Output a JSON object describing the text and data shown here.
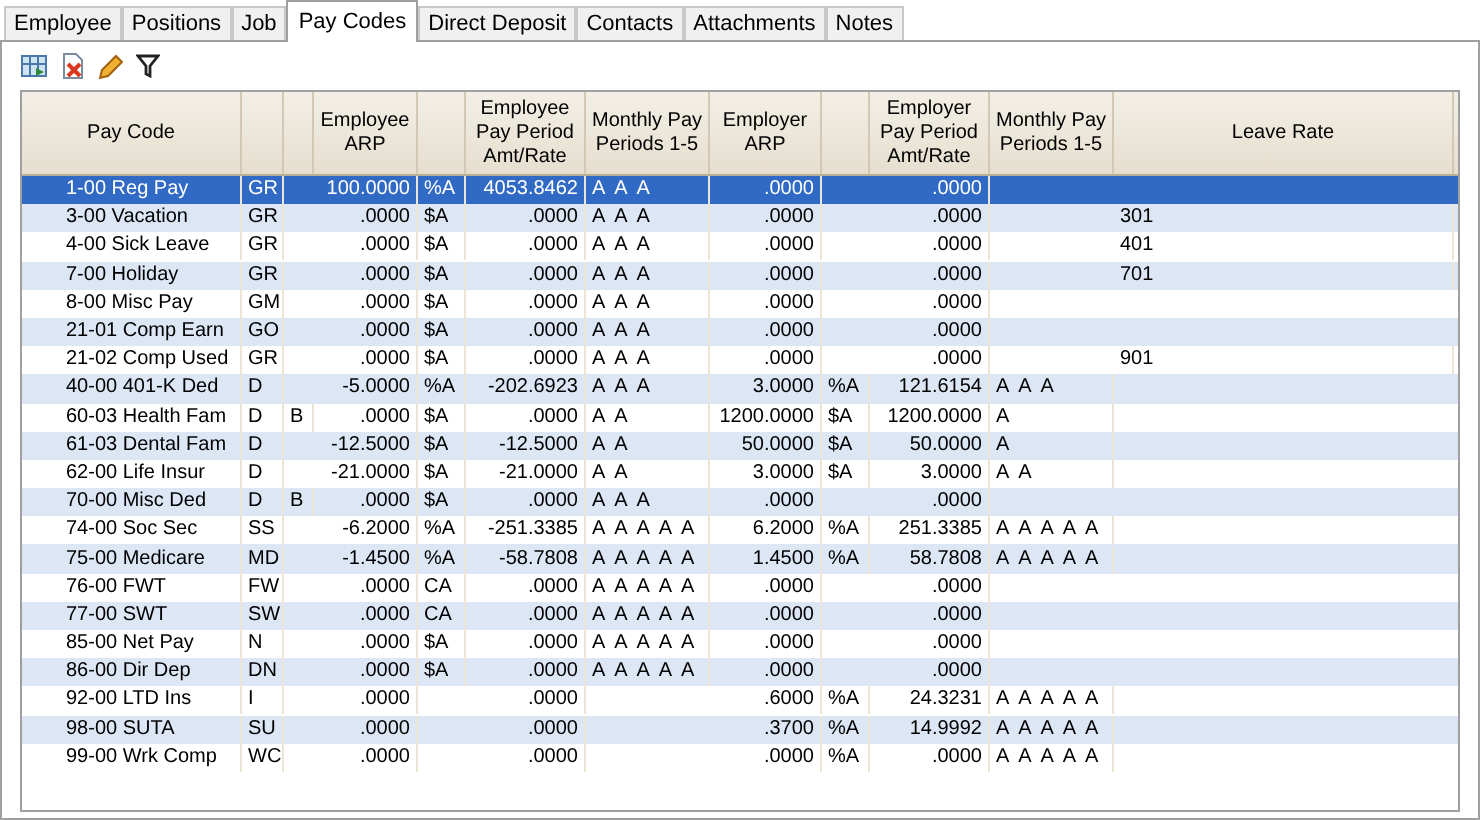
{
  "tabs": [
    {
      "label": "Employee",
      "selected": false
    },
    {
      "label": "Positions",
      "selected": false
    },
    {
      "label": "Job",
      "selected": false
    },
    {
      "label": "Pay Codes",
      "selected": true
    },
    {
      "label": "Direct Deposit",
      "selected": false
    },
    {
      "label": "Contacts",
      "selected": false
    },
    {
      "label": "Attachments",
      "selected": false
    },
    {
      "label": "Notes",
      "selected": false
    }
  ],
  "table": {
    "columns": [
      "Pay Code",
      "",
      "",
      "Employee ARP",
      "",
      "Employee Pay Period Amt/Rate",
      "Monthly Pay Periods 1-5",
      "Employer ARP",
      "",
      "Employer Pay Period Amt/Rate",
      "Monthly Pay Periods 1-5",
      "Leave Rate"
    ],
    "rows": [
      {
        "cells": [
          "1-00 Reg Pay",
          "GR",
          "",
          "100.0000",
          "%A",
          "4053.8462",
          "A  A  A",
          ".0000",
          "",
          ".0000",
          "",
          ""
        ],
        "selected": true
      },
      {
        "cells": [
          "3-00 Vacation",
          "GR",
          "",
          ".0000",
          "$A",
          ".0000",
          "A  A  A",
          ".0000",
          "",
          ".0000",
          "",
          "301"
        ],
        "selected": false
      },
      {
        "cells": [
          "4-00 Sick Leave",
          "GR",
          "",
          ".0000",
          "$A",
          ".0000",
          "A  A  A",
          ".0000",
          "",
          ".0000",
          "",
          "401"
        ],
        "selected": false
      },
      {
        "cells": [
          "7-00 Holiday",
          "GR",
          "",
          ".0000",
          "$A",
          ".0000",
          "A  A  A",
          ".0000",
          "",
          ".0000",
          "",
          "701"
        ],
        "selected": false
      },
      {
        "cells": [
          "8-00 Misc Pay",
          "GM",
          "",
          ".0000",
          "$A",
          ".0000",
          "A  A  A",
          ".0000",
          "",
          ".0000",
          "",
          ""
        ],
        "selected": false
      },
      {
        "cells": [
          "21-01 Comp Earn",
          "GO",
          "",
          ".0000",
          "$A",
          ".0000",
          "A  A  A",
          ".0000",
          "",
          ".0000",
          "",
          ""
        ],
        "selected": false
      },
      {
        "cells": [
          "21-02 Comp Used",
          "GR",
          "",
          ".0000",
          "$A",
          ".0000",
          "A  A  A",
          ".0000",
          "",
          ".0000",
          "",
          "901"
        ],
        "selected": false
      },
      {
        "cells": [
          "40-00 401-K Ded",
          "D",
          "",
          "-5.0000",
          "%A",
          "-202.6923",
          "A  A  A",
          "3.0000",
          "%A",
          "121.6154",
          "A  A  A",
          ""
        ],
        "selected": false
      },
      {
        "cells": [
          "60-03 Health Fam",
          "D",
          "B",
          ".0000",
          "$A",
          ".0000",
          "A  A",
          "1200.0000",
          "$A",
          "1200.0000",
          "A",
          ""
        ],
        "selected": false
      },
      {
        "cells": [
          "61-03 Dental Fam",
          "D",
          "",
          "-12.5000",
          "$A",
          "-12.5000",
          "A  A",
          "50.0000",
          "$A",
          "50.0000",
          "A",
          ""
        ],
        "selected": false
      },
      {
        "cells": [
          "62-00 Life Insur",
          "D",
          "",
          "-21.0000",
          "$A",
          "-21.0000",
          "A  A",
          "3.0000",
          "$A",
          "3.0000",
          "A  A",
          ""
        ],
        "selected": false
      },
      {
        "cells": [
          "70-00 Misc Ded",
          "D",
          "B",
          ".0000",
          "$A",
          ".0000",
          "A  A  A",
          ".0000",
          "",
          ".0000",
          "",
          ""
        ],
        "selected": false
      },
      {
        "cells": [
          "74-00 Soc Sec",
          "SS",
          "",
          "-6.2000",
          "%A",
          "-251.3385",
          "A  A  A  A  A",
          "6.2000",
          "%A",
          "251.3385",
          "A  A  A  A  A",
          ""
        ],
        "selected": false
      },
      {
        "cells": [
          "75-00 Medicare",
          "MD",
          "",
          "-1.4500",
          "%A",
          "-58.7808",
          "A  A  A  A  A",
          "1.4500",
          "%A",
          "58.7808",
          "A  A  A  A  A",
          ""
        ],
        "selected": false
      },
      {
        "cells": [
          "76-00 FWT",
          "FW",
          "",
          ".0000",
          "CA",
          ".0000",
          "A  A  A  A  A",
          ".0000",
          "",
          ".0000",
          "",
          ""
        ],
        "selected": false
      },
      {
        "cells": [
          "77-00 SWT",
          "SW",
          "",
          ".0000",
          "CA",
          ".0000",
          "A  A  A  A  A",
          ".0000",
          "",
          ".0000",
          "",
          ""
        ],
        "selected": false
      },
      {
        "cells": [
          "85-00 Net Pay",
          "N",
          "",
          ".0000",
          "$A",
          ".0000",
          "A  A  A  A  A",
          ".0000",
          "",
          ".0000",
          "",
          ""
        ],
        "selected": false
      },
      {
        "cells": [
          "86-00 Dir Dep",
          "DN",
          "",
          ".0000",
          "$A",
          ".0000",
          "A  A  A  A  A",
          ".0000",
          "",
          ".0000",
          "",
          ""
        ],
        "selected": false
      },
      {
        "cells": [
          "92-00 LTD Ins",
          "I",
          "",
          ".0000",
          "",
          ".0000",
          "",
          ".6000",
          "%A",
          "24.3231",
          "A  A  A  A  A",
          ""
        ],
        "selected": false
      },
      {
        "cells": [
          "98-00 SUTA",
          "SU",
          "",
          ".0000",
          "",
          ".0000",
          "",
          ".3700",
          "%A",
          "14.9992",
          "A  A  A  A  A",
          ""
        ],
        "selected": false
      },
      {
        "cells": [
          "99-00 Wrk Comp",
          "WC",
          "",
          ".0000",
          "",
          ".0000",
          "",
          ".0000",
          "%A",
          ".0000",
          "A  A  A  A  A",
          ""
        ],
        "selected": false
      }
    ]
  }
}
